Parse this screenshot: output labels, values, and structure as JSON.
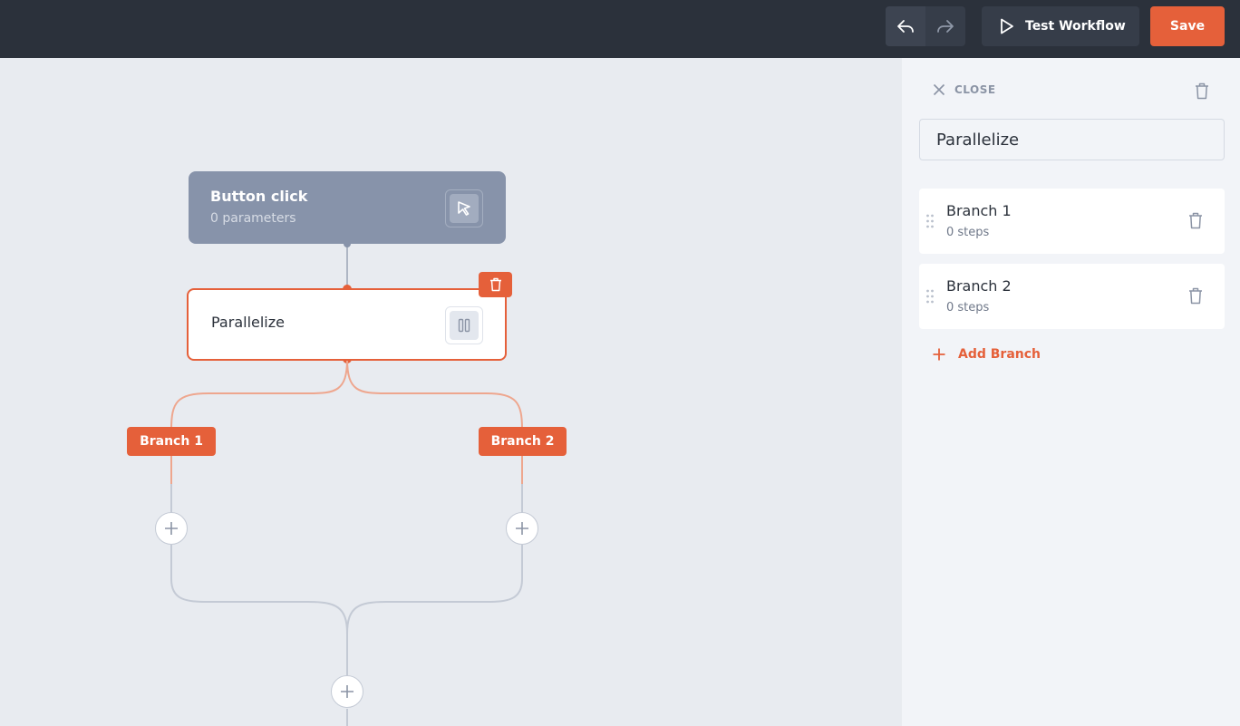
{
  "toolbar": {
    "undo_icon": "undo-icon",
    "redo_icon": "redo-icon",
    "test_label": "Test Workflow",
    "save_label": "Save"
  },
  "canvas": {
    "trigger": {
      "title": "Button click",
      "subtitle": "0 parameters",
      "icon": "cursor-icon"
    },
    "parallel": {
      "title": "Parallelize",
      "icon": "parallel-icon"
    },
    "branches": [
      {
        "label": "Branch 1"
      },
      {
        "label": "Branch 2"
      }
    ]
  },
  "panel": {
    "close_label": "CLOSE",
    "name_value": "Parallelize",
    "branches": [
      {
        "name": "Branch 1",
        "steps": "0 steps"
      },
      {
        "name": "Branch 2",
        "steps": "0 steps"
      }
    ],
    "add_branch_label": "Add Branch"
  },
  "colors": {
    "accent": "#e5603a",
    "topbar": "#2b313b",
    "canvas": "#e8ebf0",
    "trigger_node": "#8793aa"
  }
}
